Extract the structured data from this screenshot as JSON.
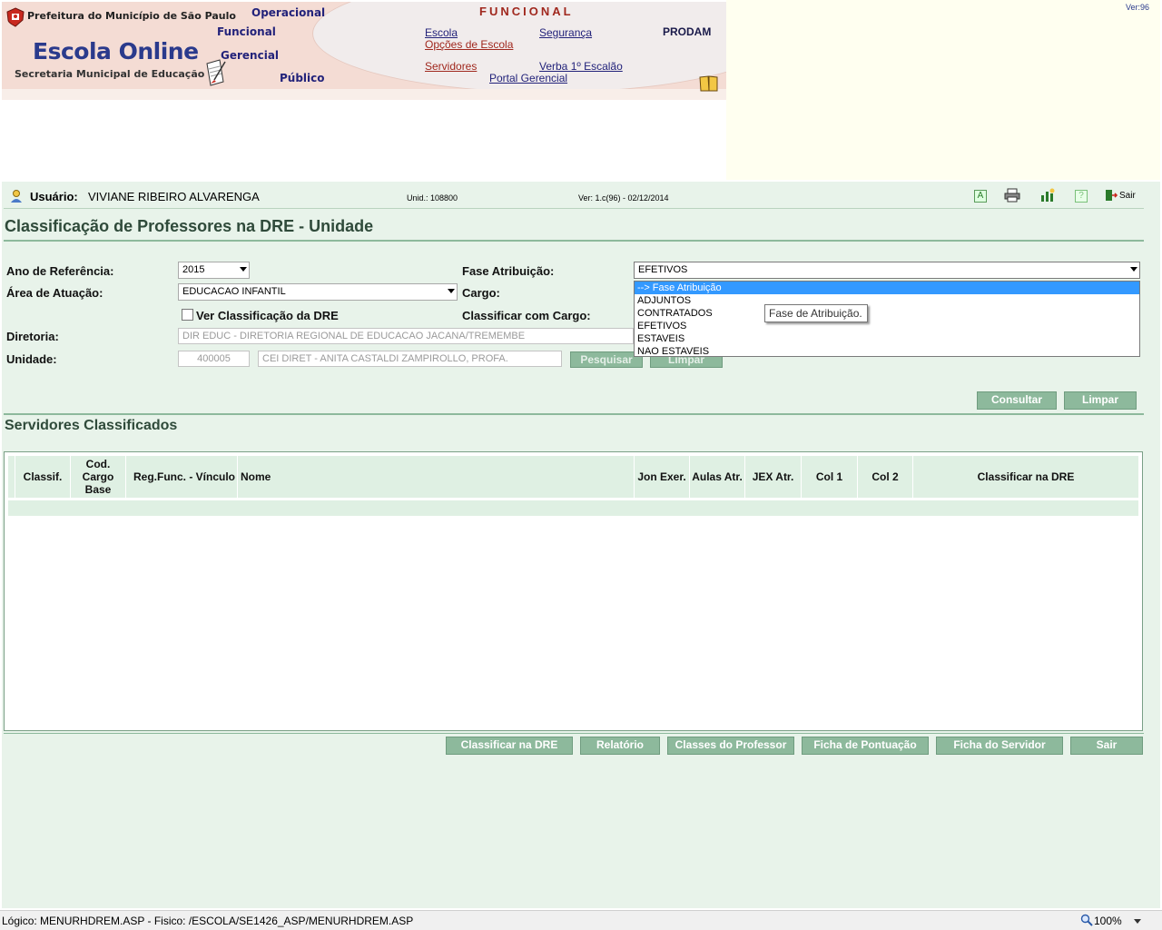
{
  "header": {
    "prefeitura": "Prefeitura do Município de São Paulo",
    "app_title": "Escola Online",
    "secretaria": "Secretaria Municipal de Educação",
    "wave_links": [
      "Operacional",
      "Funcional",
      "Gerencial",
      "Público"
    ],
    "module_title": "FUNCIONAL",
    "links": {
      "escola": "Escola",
      "opcoes_escola": "Opções de Escola",
      "seguranca": "Segurança",
      "prodam": "PRODAM",
      "servidores": "Servidores",
      "verba": "Verba 1º Escalão",
      "portal_gerencial": "Portal Gerencial"
    },
    "version_tag": "Ver:96"
  },
  "userbar": {
    "user_label": "Usuário:",
    "user_name": "VIVIANE RIBEIRO ALVARENGA",
    "unit": "Unid.: 108800",
    "version": "Ver: 1.c(96) - 02/12/2014",
    "sair": "Sair"
  },
  "page_title": "Classificação de Professores na DRE - Unidade",
  "form": {
    "ano_label": "Ano de Referência:",
    "ano_value": "2015",
    "area_label": "Área de Atuação:",
    "area_value": "EDUCACAO INFANTIL",
    "ver_classificacao_label": "Ver Classificação da DRE",
    "diretoria_label": "Diretoria:",
    "diretoria_value": "DIR EDUC - DIRETORIA REGIONAL DE EDUCACAO JACANA/TREMEMBE",
    "unidade_label": "Unidade:",
    "unidade_code": "400005",
    "unidade_name": "CEI DIRET - ANITA CASTALDI ZAMPIROLLO, PROFA.",
    "pesquisar": "Pesquisar",
    "limpar_small": "Limpar",
    "fase_label": "Fase Atribuição:",
    "fase_value": "EFETIVOS",
    "cargo_label": "Cargo:",
    "classificar_cargo_label": "Classificar com Cargo:",
    "fase_options": [
      "--> Fase Atribuição",
      "ADJUNTOS",
      "CONTRATADOS",
      "EFETIVOS",
      "ESTAVEIS",
      "NAO ESTAVEIS"
    ],
    "fase_tooltip": "Fase de Atribuição."
  },
  "actions": {
    "consultar": "Consultar",
    "limpar": "Limpar"
  },
  "section_title": "Servidores Classificados",
  "table": {
    "headers": {
      "classif": "Classif.",
      "cod_cargo_base": "Cod. Cargo Base",
      "reg_func": "Reg.Func. - Vínculo",
      "nome": "Nome",
      "jon_exer": "Jon Exer.",
      "aulas_atr": "Aulas Atr.",
      "jex_atr": "JEX Atr.",
      "col1": "Col 1",
      "col2": "Col 2",
      "classificar_dre": "Classificar na DRE"
    }
  },
  "bottom_buttons": {
    "classificar_dre": "Classificar na DRE",
    "relatorio": "Relatório",
    "classes_professor": "Classes do Professor",
    "ficha_pontuacao": "Ficha de Pontuação",
    "ficha_servidor": "Ficha do Servidor",
    "sair": "Sair"
  },
  "status_bar": {
    "path": "Lógico: MENURHDREM.ASP - Fisico: /ESCOLA/SE1426_ASP/MENURHDREM.ASP",
    "zoom": "100%"
  },
  "colors": {
    "accent_green": "#8db99c",
    "pane_bg": "#e8f3ea",
    "banner_pink": "#f4dcd4",
    "title_green": "#2f4a3a"
  },
  "icons": [
    "prefeitura-crest-icon",
    "scroll-pen-icon",
    "book-icon",
    "user-icon",
    "font-size-icon",
    "print-icon",
    "chart-icon",
    "help-icon",
    "exit-door-icon",
    "zoom-icon"
  ]
}
